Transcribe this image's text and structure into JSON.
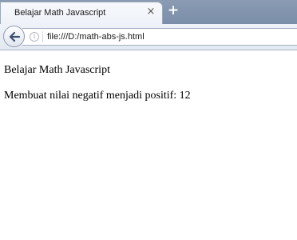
{
  "browser": {
    "tab": {
      "title": "Belajar Math Javascript",
      "close_glyph": "×"
    },
    "new_tab_glyph": "+",
    "address_bar": {
      "url": "file:///D:/math-abs-js.html",
      "info_glyph": "i"
    }
  },
  "page": {
    "heading_text": "Belajar Math Javascript",
    "result_text": "Membuat nilai negatif menjadi positif: 12"
  },
  "icons": {
    "back": "back-arrow-icon",
    "info": "info-icon",
    "close": "close-icon",
    "new_tab": "plus-icon"
  }
}
